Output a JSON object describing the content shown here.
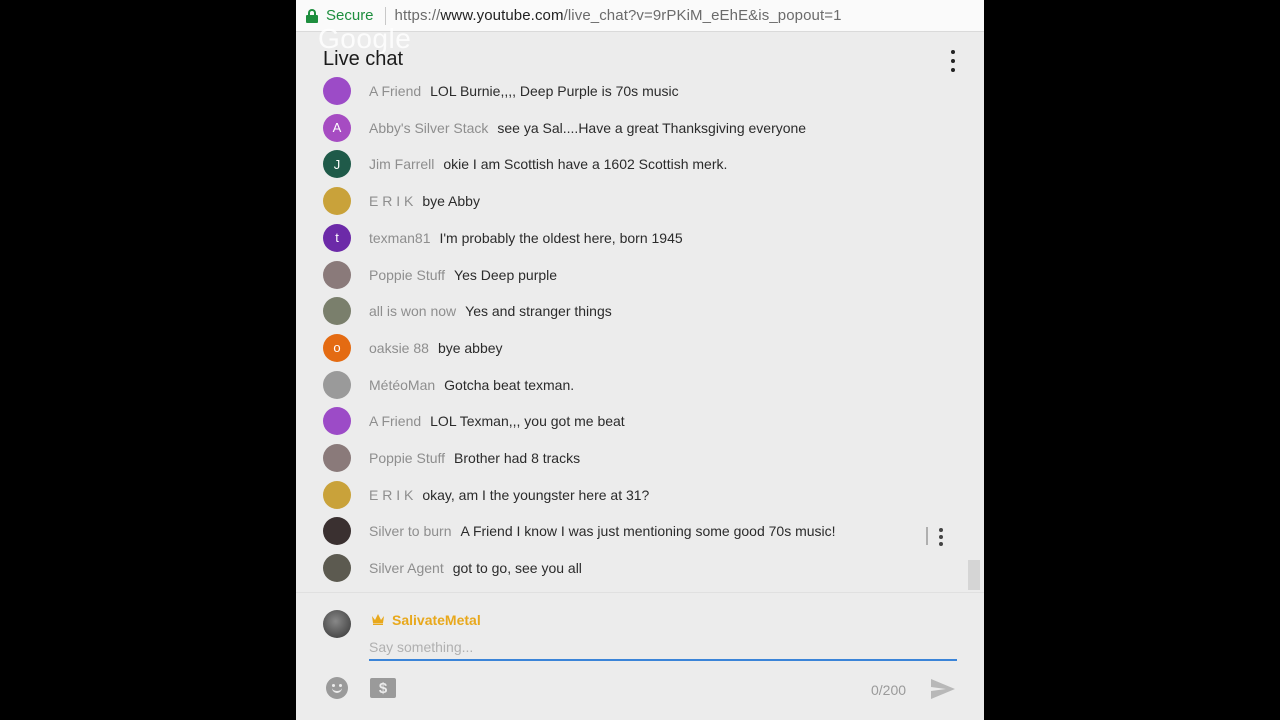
{
  "browser": {
    "secure_label": "Secure",
    "url_scheme": "https://",
    "url_host": "www.youtube.com",
    "url_path": "/live_chat?v=9rPKiM_eEhE&is_popout=1"
  },
  "header": {
    "watermark": "Google",
    "title": "Live chat"
  },
  "messages": [
    {
      "author": "A Friend",
      "text": "LOL Burnie,,,, Deep Purple is 70s music",
      "avatar_letter": "",
      "avatar_color": "#9c4bc7"
    },
    {
      "author": "Abby's Silver Stack",
      "text": "see ya Sal....Have a great Thanksgiving everyone",
      "avatar_letter": "A",
      "avatar_color": "#a64cc2"
    },
    {
      "author": "Jim Farrell",
      "text": "okie I am Scottish have a 1602 Scottish merk.",
      "avatar_letter": "J",
      "avatar_color": "#1f5a49"
    },
    {
      "author": "E R I K",
      "text": "bye Abby",
      "avatar_letter": "",
      "avatar_color": "#c9a23a"
    },
    {
      "author": "texman81",
      "text": "I'm probably the oldest here, born 1945",
      "avatar_letter": "t",
      "avatar_color": "#6c2aa8"
    },
    {
      "author": "Poppie Stuff",
      "text": "Yes Deep purple",
      "avatar_letter": "",
      "avatar_color": "#8a7a7a"
    },
    {
      "author": "all is won now",
      "text": "Yes and stranger things",
      "avatar_letter": "",
      "avatar_color": "#7a7f6c"
    },
    {
      "author": "oaksie 88",
      "text": "bye abbey",
      "avatar_letter": "o",
      "avatar_color": "#e46b12"
    },
    {
      "author": "MétéoMan",
      "text": "Gotcha beat texman.",
      "avatar_letter": "",
      "avatar_color": "#9a9a9a"
    },
    {
      "author": "A Friend",
      "text": "LOL Texman,,, you got me beat",
      "avatar_letter": "",
      "avatar_color": "#9c4bc7"
    },
    {
      "author": "Poppie Stuff",
      "text": "Brother had 8 tracks",
      "avatar_letter": "",
      "avatar_color": "#8a7a7a"
    },
    {
      "author": "E R I K",
      "text": "okay, am I the youngster here at 31?",
      "avatar_letter": "",
      "avatar_color": "#c9a23a"
    },
    {
      "author": "Silver to burn",
      "text": "A Friend I know I was just mentioning some good 70s music!",
      "avatar_letter": "",
      "avatar_color": "#3a3030"
    },
    {
      "author": "Silver Agent",
      "text": "got to go, see you all",
      "avatar_letter": "",
      "avatar_color": "#5c5a50"
    }
  ],
  "composer": {
    "username": "SalivateMetal",
    "placeholder": "Say something...",
    "counter": "0/200"
  },
  "icons": {
    "lock": "lock-icon",
    "menu": "more-vert-icon",
    "emoji": "emoji-icon",
    "super_chat": "dollar-icon",
    "send": "send-icon",
    "crown": "crown-icon"
  },
  "colors": {
    "secure_green": "#1e8e3e",
    "owner_gold": "#e8a81c",
    "focus_blue": "#3a84d8"
  }
}
